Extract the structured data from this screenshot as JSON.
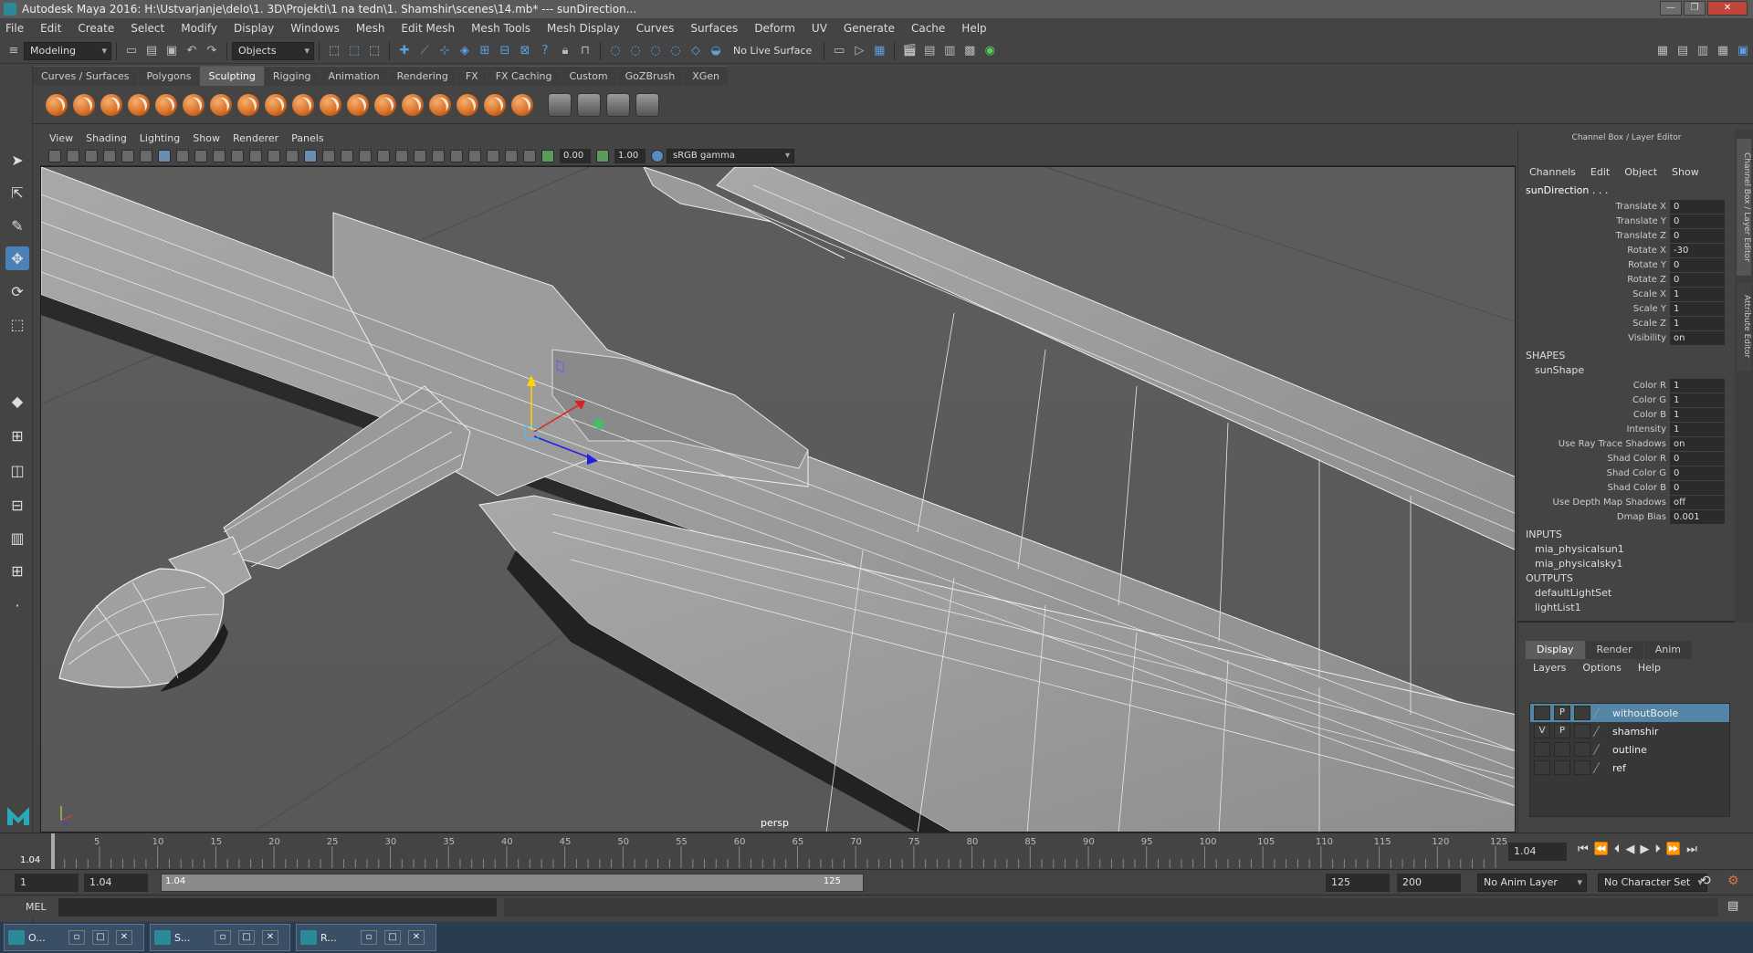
{
  "window": {
    "title": "Autodesk Maya 2016: H:\\Ustvarjanje\\delo\\1. 3D\\Projekti\\1 na tedn\\1. Shamshir\\scenes\\14.mb*   ---   sunDirection...",
    "min": "—",
    "max": "❐",
    "close": "✕"
  },
  "menubar": [
    "File",
    "Edit",
    "Create",
    "Select",
    "Modify",
    "Display",
    "Windows",
    "Mesh",
    "Edit Mesh",
    "Mesh Tools",
    "Mesh Display",
    "Curves",
    "Surfaces",
    "Deform",
    "UV",
    "Generate",
    "Cache",
    "Help"
  ],
  "statusline": {
    "mode": "Modeling",
    "selection_mode": "Objects",
    "live_surface": "No Live Surface"
  },
  "shelf": {
    "tabs": [
      "Curves / Surfaces",
      "Polygons",
      "Sculpting",
      "Rigging",
      "Animation",
      "Rendering",
      "FX",
      "FX Caching",
      "Custom",
      "GoZBrush",
      "XGen"
    ],
    "active_tab": "Sculpting"
  },
  "panel": {
    "menu": [
      "View",
      "Shading",
      "Lighting",
      "Show",
      "Renderer",
      "Panels"
    ],
    "near_value": "0.00",
    "far_value": "1.00",
    "color_space": "sRGB gamma",
    "camera_label": "persp"
  },
  "channel_box": {
    "header": "Channel Box / Layer Editor",
    "menu": [
      "Channels",
      "Edit",
      "Object",
      "Show"
    ],
    "object": "sunDirection . . .",
    "transform": [
      {
        "label": "Translate X",
        "value": "0"
      },
      {
        "label": "Translate Y",
        "value": "0"
      },
      {
        "label": "Translate Z",
        "value": "0"
      },
      {
        "label": "Rotate X",
        "value": "-30"
      },
      {
        "label": "Rotate Y",
        "value": "0"
      },
      {
        "label": "Rotate Z",
        "value": "0"
      },
      {
        "label": "Scale X",
        "value": "1"
      },
      {
        "label": "Scale Y",
        "value": "1"
      },
      {
        "label": "Scale Z",
        "value": "1"
      },
      {
        "label": "Visibility",
        "value": "on"
      }
    ],
    "shapes_title": "SHAPES",
    "shape_name": "sunShape",
    "shape_attrs": [
      {
        "label": "Color R",
        "value": "1"
      },
      {
        "label": "Color G",
        "value": "1"
      },
      {
        "label": "Color B",
        "value": "1"
      },
      {
        "label": "Intensity",
        "value": "1"
      },
      {
        "label": "Use Ray Trace Shadows",
        "value": "on"
      },
      {
        "label": "Shad Color R",
        "value": "0"
      },
      {
        "label": "Shad Color G",
        "value": "0"
      },
      {
        "label": "Shad Color B",
        "value": "0"
      },
      {
        "label": "Use Depth Map Shadows",
        "value": "off"
      },
      {
        "label": "Dmap Bias",
        "value": "0.001"
      }
    ],
    "inputs_title": "INPUTS",
    "inputs": [
      "mia_physicalsun1",
      "mia_physicalsky1"
    ],
    "outputs_title": "OUTPUTS",
    "outputs": [
      "defaultLightSet",
      "lightList1"
    ],
    "side_tabs": [
      "Channel Box / Layer Editor",
      "Attribute Editor"
    ]
  },
  "layer_editor": {
    "tabs": [
      "Display",
      "Render",
      "Anim"
    ],
    "active_tab": "Display",
    "menu": [
      "Layers",
      "Options",
      "Help"
    ],
    "layers": [
      {
        "v": "",
        "p": "P",
        "name": "withoutBoole",
        "selected": true
      },
      {
        "v": "V",
        "p": "P",
        "name": "shamshir",
        "selected": false
      },
      {
        "v": "",
        "p": "",
        "name": "outline",
        "selected": false
      },
      {
        "v": "",
        "p": "",
        "name": "ref",
        "selected": false
      }
    ]
  },
  "timeline": {
    "ticks": [
      "5",
      "10",
      "15",
      "20",
      "25",
      "30",
      "35",
      "40",
      "45",
      "50",
      "55",
      "60",
      "65",
      "70",
      "75",
      "80",
      "85",
      "90",
      "95",
      "100",
      "105",
      "110",
      "115",
      "120",
      "125"
    ],
    "current_frame_left": "1.04",
    "current_frame_field": "1.04"
  },
  "range": {
    "start": "1",
    "playback_start": "1.04",
    "slider_start": "1.04",
    "slider_end": "125",
    "playback_end": "125",
    "end": "200",
    "anim_layer": "No Anim Layer",
    "character_set": "No Character Set"
  },
  "command_line": {
    "label": "MEL"
  },
  "taskbar": [
    {
      "label": "O...",
      "min": "▫",
      "max": "□",
      "close": "✕"
    },
    {
      "label": "S...",
      "min": "▫",
      "max": "□",
      "close": "✕"
    },
    {
      "label": "R...",
      "min": "▫",
      "max": "□",
      "close": "✕"
    }
  ],
  "colors": {
    "selection_blue": "#5285a6",
    "accent_orange": "#d56a20",
    "viewport_bg": "#5f5f5f"
  }
}
